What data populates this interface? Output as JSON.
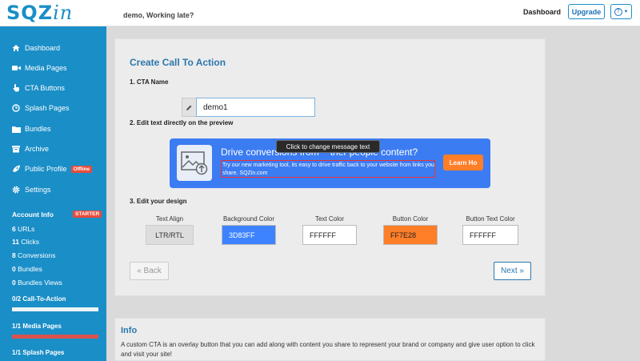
{
  "header": {
    "logo_main": "SQZ",
    "logo_suffix": "in",
    "greeting": "demo, Working late?",
    "nav_dashboard": "Dashboard",
    "upgrade_label": "Upgrade",
    "help_label": "?"
  },
  "sidebar": {
    "items": [
      {
        "label": "Dashboard",
        "icon": "home-icon"
      },
      {
        "label": "Media Pages",
        "icon": "video-icon"
      },
      {
        "label": "CTA Buttons",
        "icon": "hand-pointer-icon"
      },
      {
        "label": "Splash Pages",
        "icon": "clock-icon"
      },
      {
        "label": "Bundles",
        "icon": "folder-icon"
      },
      {
        "label": "Archive",
        "icon": "archive-icon"
      },
      {
        "label": "Public Profile",
        "icon": "rocket-icon",
        "badge": "Offline"
      },
      {
        "label": "Settings",
        "icon": "gear-icon"
      }
    ],
    "account": {
      "title": "Account Info",
      "badge": "STARTER",
      "stats": [
        {
          "value": "6",
          "label": "URLs"
        },
        {
          "value": "11",
          "label": "Clicks"
        },
        {
          "value": "8",
          "label": "Conversions"
        },
        {
          "value": "0",
          "label": "Bundles"
        },
        {
          "value": "0",
          "label": "Bundles Views"
        }
      ],
      "progress": [
        {
          "label": "0/2 Call-To-Action",
          "fraction": 0.0
        },
        {
          "label": "1/1 Media Pages",
          "fraction": 1.0
        },
        {
          "label": "1/1 Splash Pages",
          "fraction": 1.0
        }
      ]
    }
  },
  "main": {
    "title": "Create Call To Action",
    "sections": {
      "name": "1. CTA Name",
      "edit_text": "2. Edit text directly on the preview",
      "design": "3. Edit your design"
    },
    "cta_name_value": "demo1",
    "preview": {
      "headline_left": "Drive conversions from",
      "headline_right": "ther people content?",
      "message": "Try our  new marketing tool, its easy to drive traffic back to your website from links you share. SQZin.com",
      "button_label": "Learn Ho",
      "tooltip": "Click to change message text",
      "bg_color": "#3c7cf2",
      "button_color": "#ff7e28"
    },
    "design": {
      "text_align_label": "Text Align",
      "text_align_value": "LTR/RTL",
      "bg_color_label": "Background Color",
      "bg_color_value": "3D83FF",
      "text_color_label": "Text Color",
      "text_color_value": "FFFFFF",
      "button_color_label": "Button Color",
      "button_color_value": "FF7E28",
      "button_text_color_label": "Button Text Color",
      "button_text_color_value": "FFFFFF"
    },
    "back_label": "« Back",
    "next_label": "Next »"
  },
  "info": {
    "title": "Info",
    "text": "A custom CTA is an overlay button that you can add along with content you share to represent your brand or company and give user option to click and visit your site!"
  }
}
